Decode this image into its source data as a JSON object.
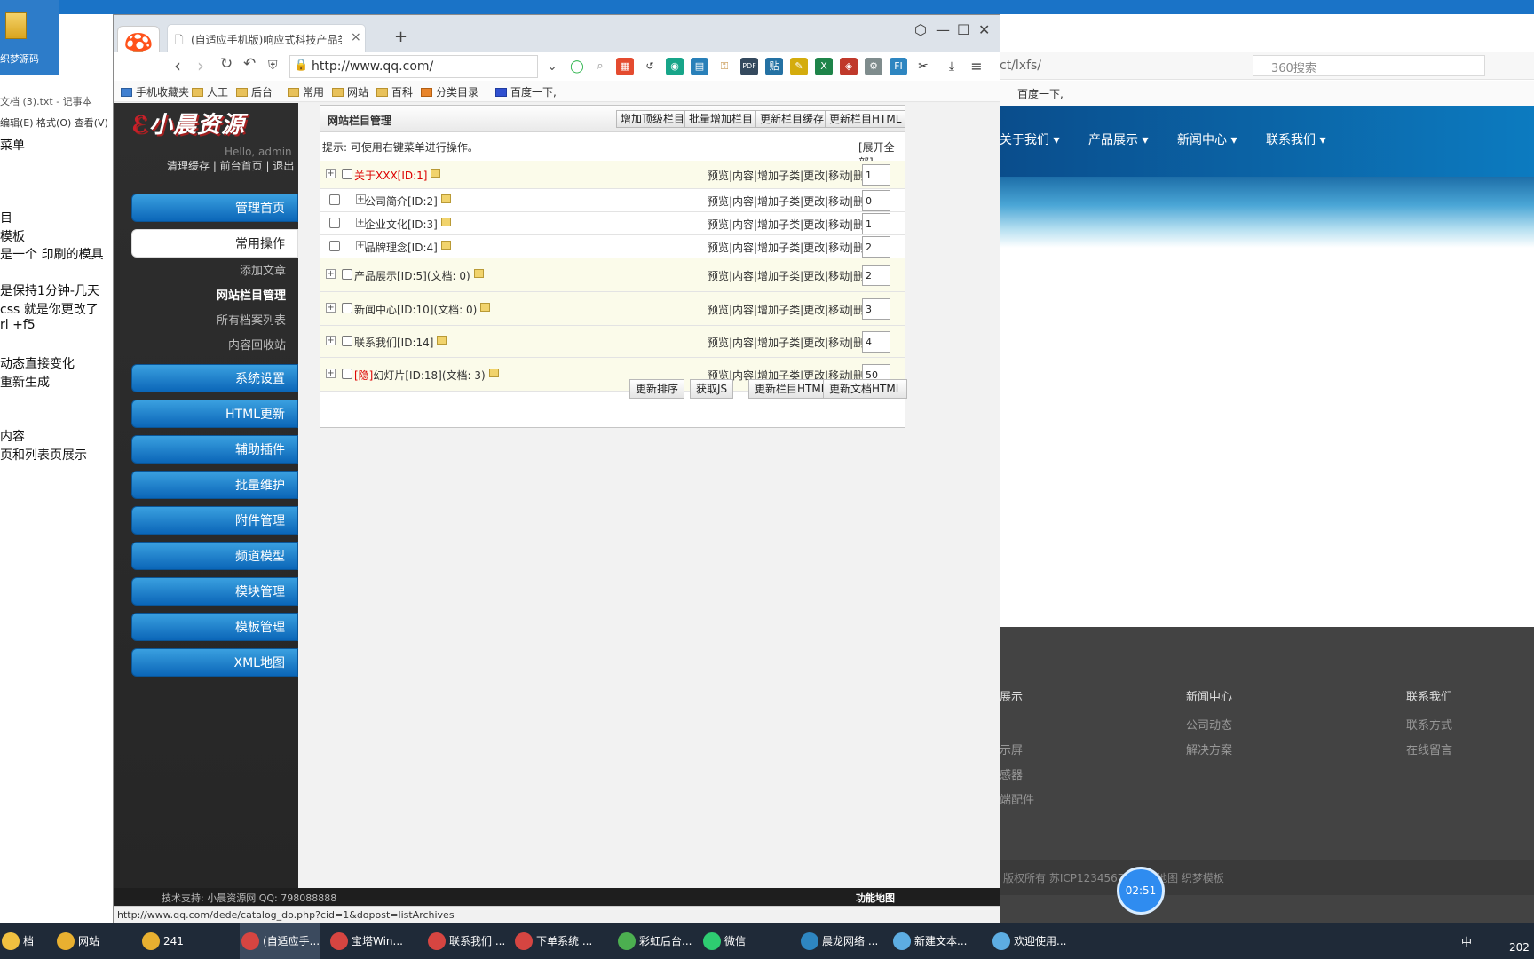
{
  "desktop": {
    "icon_label": "织梦源码",
    "notepad_title": "文档 (3).txt - 记事本",
    "notepad_menu": "编辑(E)  格式(O)  查看(V)",
    "notepad_lines": [
      "菜单",
      "",
      "",
      "",
      "目",
      "模板",
      "是一个 印刷的模具",
      "",
      "是保持1分钟-几天",
      "css   就是你更改了",
      "rl +f5",
      "",
      "动态直接变化",
      "重新生成",
      "",
      "",
      "内容",
      "页和列表页展示"
    ]
  },
  "bgsite": {
    "url": "ct/lxfs/",
    "search_placeholder": "360搜索",
    "bookmark": "百度一下,",
    "nav": [
      "关于我们 ▾",
      "产品展示 ▾",
      "新闻中心 ▾",
      "联系我们 ▾"
    ],
    "footer": {
      "col1": "展示",
      "col1_links": [
        "示屏",
        "感器",
        "端配件"
      ],
      "col2": "新闻中心",
      "col2_links": [
        "公司动态",
        "解决方案"
      ],
      "col3": "联系我们",
      "col3_links": [
        "联系方式",
        "在线留言"
      ],
      "copyright": "版权所有 苏ICP12345678 XML地图 织梦模板"
    },
    "timer": "02:51"
  },
  "browser": {
    "tab_title": "(自适应手机版)响应式科技产品类",
    "tab_close": "×",
    "tab_new": "+",
    "url": "http://www.qq.com/",
    "bookmarks": [
      "手机收藏夹",
      "人工",
      "后台",
      "常用",
      "网站",
      "百科",
      "分类目录",
      "百度一下,"
    ],
    "status_url": "http://www.qq.com/dede/catalog_do.php?cid=1&dopost=listArchives"
  },
  "sidebar": {
    "brand": "小晨资源",
    "hello": "Hello, admin",
    "links": "清理缓存 | 前台首页 | 退出",
    "menu": [
      "管理首页",
      "常用操作",
      "系统设置",
      "HTML更新",
      "辅助插件",
      "批量维护",
      "附件管理",
      "频道模型",
      "模块管理",
      "模板管理",
      "XML地图"
    ],
    "sub": [
      "添加文章",
      "网站栏目管理",
      "所有档案列表",
      "内容回收站"
    ],
    "support": "技术支持: 小晨资源网     QQ: 798088888",
    "map": "功能地图"
  },
  "panel": {
    "title": "网站栏目管理",
    "buttons": [
      "增加顶级栏目",
      "批量增加栏目",
      "更新栏目缓存",
      "更新栏目HTML"
    ],
    "tip": "提示: 可使用右键菜单进行操作。",
    "expand": "[展开全部]",
    "actions": "预览|内容|增加子类|更改|移动|删除",
    "rows": [
      {
        "name": "关于XXX[ID:1]",
        "order": "1",
        "kind": "top",
        "red": true
      },
      {
        "name": "公司简介[ID:2]",
        "order": "0",
        "kind": "child"
      },
      {
        "name": "企业文化[ID:3]",
        "order": "1",
        "kind": "child"
      },
      {
        "name": "品牌理念[ID:4]",
        "order": "2",
        "kind": "child"
      },
      {
        "name": "产品展示[ID:5](文档: 0)",
        "order": "2",
        "kind": "top"
      },
      {
        "name": "新闻中心[ID:10](文档: 0)",
        "order": "3",
        "kind": "top"
      },
      {
        "name": "联系我们[ID:14]",
        "order": "4",
        "kind": "top"
      },
      {
        "name": "幻灯片[ID:18](文档: 3)",
        "order": "50",
        "kind": "top",
        "hidden_tag": "[隐]"
      }
    ],
    "footer_buttons": [
      "更新排序",
      "获取JS",
      "更新栏目HTML",
      "更新文档HTML"
    ]
  },
  "taskbar": {
    "items": [
      "档",
      "网站",
      "241",
      "(自适应手...",
      "宝塔Win...",
      "联系我们 ...",
      "下单系统 ...",
      "彩虹后台...",
      "微信",
      "晨龙网络 ...",
      "新建文本...",
      "欢迎使用..."
    ],
    "clock": "202",
    "ime": "中"
  }
}
